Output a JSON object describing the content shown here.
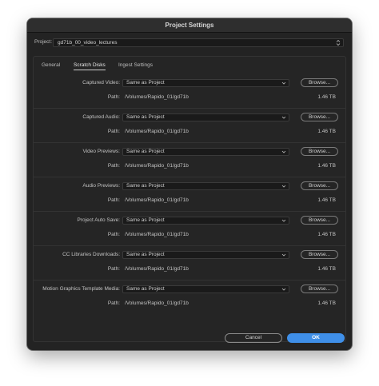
{
  "window": {
    "title": "Project Settings"
  },
  "project": {
    "label": "Project:",
    "value": "gd71b_00_video_lectures"
  },
  "tabs": [
    {
      "label": "General",
      "active": false
    },
    {
      "label": "Scratch Disks",
      "active": true
    },
    {
      "label": "Ingest Settings",
      "active": false
    }
  ],
  "sections": [
    {
      "label": "Captured Video:",
      "value": "Same as Project",
      "path_label": "Path:",
      "path": "/Volumes/Rapido_01/gd71b",
      "size": "1.46 TB",
      "browse": "Browse..."
    },
    {
      "label": "Captured Audio:",
      "value": "Same as Project",
      "path_label": "Path:",
      "path": "/Volumes/Rapido_01/gd71b",
      "size": "1.46 TB",
      "browse": "Browse..."
    },
    {
      "label": "Video Previews:",
      "value": "Same as Project",
      "path_label": "Path:",
      "path": "/Volumes/Rapido_01/gd71b",
      "size": "1.46 TB",
      "browse": "Browse..."
    },
    {
      "label": "Audio Previews:",
      "value": "Same as Project",
      "path_label": "Path:",
      "path": "/Volumes/Rapido_01/gd71b",
      "size": "1.46 TB",
      "browse": "Browse..."
    },
    {
      "label": "Project Auto Save:",
      "value": "Same as Project",
      "path_label": "Path:",
      "path": "/Volumes/Rapido_01/gd71b",
      "size": "1.46 TB",
      "browse": "Browse..."
    },
    {
      "label": "CC Libraries Downloads:",
      "value": "Same as Project",
      "path_label": "Path:",
      "path": "/Volumes/Rapido_01/gd71b",
      "size": "1.46 TB",
      "browse": "Browse..."
    },
    {
      "label": "Motion Graphics Template Media:",
      "value": "Same as Project",
      "path_label": "Path:",
      "path": "/Volumes/Rapido_01/gd71b",
      "size": "1.46 TB",
      "browse": "Browse..."
    }
  ],
  "footer": {
    "cancel_label": "Cancel",
    "ok_label": "OK"
  },
  "colors": {
    "accent": "#3f8fe8",
    "window_bg": "#232323",
    "field_bg": "#1a1a1a"
  },
  "icons": {
    "dropdown": "chevron-down-icon"
  }
}
